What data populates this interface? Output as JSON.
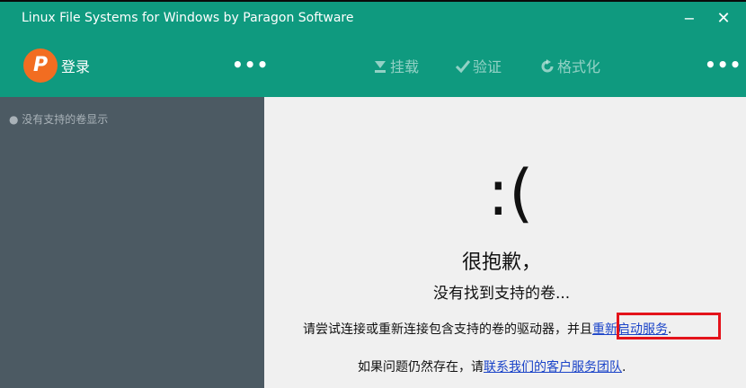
{
  "window": {
    "title": "Linux File Systems for Windows by Paragon Software",
    "minimize_glyph": "−",
    "close_glyph": "✕"
  },
  "toolbar": {
    "logo_letter": "P",
    "login_label": "登录",
    "more_left": "•••",
    "mount_label": "挂载",
    "verify_label": "验证",
    "format_label": "格式化",
    "more_right": "•••",
    "icons": {
      "mount": "eject-down-icon",
      "verify": "checkmark-icon",
      "format": "refresh-icon"
    }
  },
  "sidebar": {
    "empty_text": "没有支持的卷显示"
  },
  "main": {
    "sad_face": ":(",
    "sorry": "很抱歉，",
    "not_found": "没有找到支持的卷...",
    "retry_prefix": "请尝试连接或重新连接包含支持的卷的驱动器，并且",
    "restart_link": "重新启动服务",
    "retry_suffix": ".",
    "persist_prefix": "如果问题仍然存在，请",
    "support_link": "联系我们的客户服务团队",
    "persist_suffix": "."
  },
  "colors": {
    "teal": "#0f9a7f",
    "sidebar": "#4c5a63",
    "logo_orange": "#f26d21",
    "link": "#1a43c8",
    "highlight": "#e4131b"
  }
}
